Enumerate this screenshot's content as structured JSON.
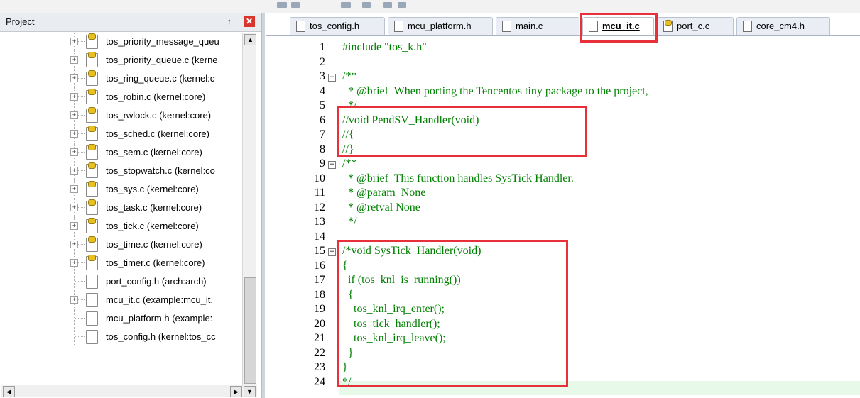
{
  "project_panel": {
    "title": "Project",
    "pin_glyph": "↑",
    "close_glyph": "✕",
    "items": [
      {
        "label": "tos_priority_message_queu",
        "icon": "keyed-file-icon",
        "expandable": true
      },
      {
        "label": "tos_priority_queue.c (kerne",
        "icon": "keyed-file-icon",
        "expandable": true
      },
      {
        "label": "tos_ring_queue.c (kernel:c",
        "icon": "keyed-file-icon",
        "expandable": true
      },
      {
        "label": "tos_robin.c (kernel:core)",
        "icon": "keyed-file-icon",
        "expandable": true
      },
      {
        "label": "tos_rwlock.c (kernel:core)",
        "icon": "keyed-file-icon",
        "expandable": true
      },
      {
        "label": "tos_sched.c (kernel:core)",
        "icon": "keyed-file-icon",
        "expandable": true
      },
      {
        "label": "tos_sem.c (kernel:core)",
        "icon": "keyed-file-icon",
        "expandable": true
      },
      {
        "label": "tos_stopwatch.c (kernel:co",
        "icon": "keyed-file-icon",
        "expandable": true
      },
      {
        "label": "tos_sys.c (kernel:core)",
        "icon": "keyed-file-icon",
        "expandable": true
      },
      {
        "label": "tos_task.c (kernel:core)",
        "icon": "keyed-file-icon",
        "expandable": true
      },
      {
        "label": "tos_tick.c (kernel:core)",
        "icon": "keyed-file-icon",
        "expandable": true
      },
      {
        "label": "tos_time.c (kernel:core)",
        "icon": "keyed-file-icon",
        "expandable": true
      },
      {
        "label": "tos_timer.c (kernel:core)",
        "icon": "keyed-file-icon",
        "expandable": true
      },
      {
        "label": "port_config.h (arch:arch)",
        "icon": "file-icon",
        "expandable": false
      },
      {
        "label": "mcu_it.c (example:mcu_it.",
        "icon": "file-icon",
        "expandable": true
      },
      {
        "label": "mcu_platform.h (example:",
        "icon": "file-icon",
        "expandable": false
      },
      {
        "label": "tos_config.h (kernel:tos_cc",
        "icon": "file-icon",
        "expandable": false
      }
    ]
  },
  "editor": {
    "tabs": [
      {
        "label": "tos_config.h",
        "active": false,
        "icon": "file-icon"
      },
      {
        "label": "mcu_platform.h",
        "active": false,
        "icon": "file-icon"
      },
      {
        "label": "main.c",
        "active": false,
        "icon": "file-icon"
      },
      {
        "label": "mcu_it.c",
        "active": true,
        "icon": "file-icon"
      },
      {
        "label": "port_c.c",
        "active": false,
        "icon": "keyed-file-icon"
      },
      {
        "label": "core_cm4.h",
        "active": false,
        "icon": "file-icon"
      }
    ],
    "lines": [
      {
        "n": "1",
        "text": "#include \"tos_k.h\"",
        "kind": "pp",
        "fold": ""
      },
      {
        "n": "2",
        "text": "",
        "kind": "plain",
        "fold": ""
      },
      {
        "n": "3",
        "text": "/**",
        "kind": "cmt",
        "fold": "−"
      },
      {
        "n": "4",
        "text": "  * @brief  When porting the Tencentos tiny package to the project,",
        "kind": "cmt",
        "fold": ""
      },
      {
        "n": "5",
        "text": "  */",
        "kind": "cmt",
        "fold": ""
      },
      {
        "n": "6",
        "text": "//void PendSV_Handler(void)",
        "kind": "cmt",
        "fold": ""
      },
      {
        "n": "7",
        "text": "//{",
        "kind": "cmt",
        "fold": ""
      },
      {
        "n": "8",
        "text": "//}",
        "kind": "cmt",
        "fold": ""
      },
      {
        "n": "9",
        "text": "/**",
        "kind": "cmt",
        "fold": "−"
      },
      {
        "n": "10",
        "text": "  * @brief  This function handles SysTick Handler.",
        "kind": "cmt",
        "fold": ""
      },
      {
        "n": "11",
        "text": "  * @param  None",
        "kind": "cmt",
        "fold": ""
      },
      {
        "n": "12",
        "text": "  * @retval None",
        "kind": "cmt",
        "fold": ""
      },
      {
        "n": "13",
        "text": "  */",
        "kind": "cmt",
        "fold": ""
      },
      {
        "n": "14",
        "text": "",
        "kind": "plain",
        "fold": ""
      },
      {
        "n": "15",
        "text": "/*void SysTick_Handler(void)",
        "kind": "cmt",
        "fold": "−"
      },
      {
        "n": "16",
        "text": "{",
        "kind": "cmt",
        "fold": ""
      },
      {
        "n": "17",
        "text": "  if (tos_knl_is_running())",
        "kind": "cmt",
        "fold": ""
      },
      {
        "n": "18",
        "text": "  {",
        "kind": "cmt",
        "fold": ""
      },
      {
        "n": "19",
        "text": "    tos_knl_irq_enter();",
        "kind": "cmt",
        "fold": ""
      },
      {
        "n": "20",
        "text": "    tos_tick_handler();",
        "kind": "cmt",
        "fold": ""
      },
      {
        "n": "21",
        "text": "    tos_knl_irq_leave();",
        "kind": "cmt",
        "fold": ""
      },
      {
        "n": "22",
        "text": "  }",
        "kind": "cmt",
        "fold": ""
      },
      {
        "n": "23",
        "text": "}",
        "kind": "cmt",
        "fold": ""
      },
      {
        "n": "24",
        "text": "*/",
        "kind": "cmt",
        "fold": ""
      }
    ]
  },
  "colors": {
    "comment": "#008000",
    "highlight_box": "#e8303a",
    "current_line": "#e7f9e8"
  }
}
